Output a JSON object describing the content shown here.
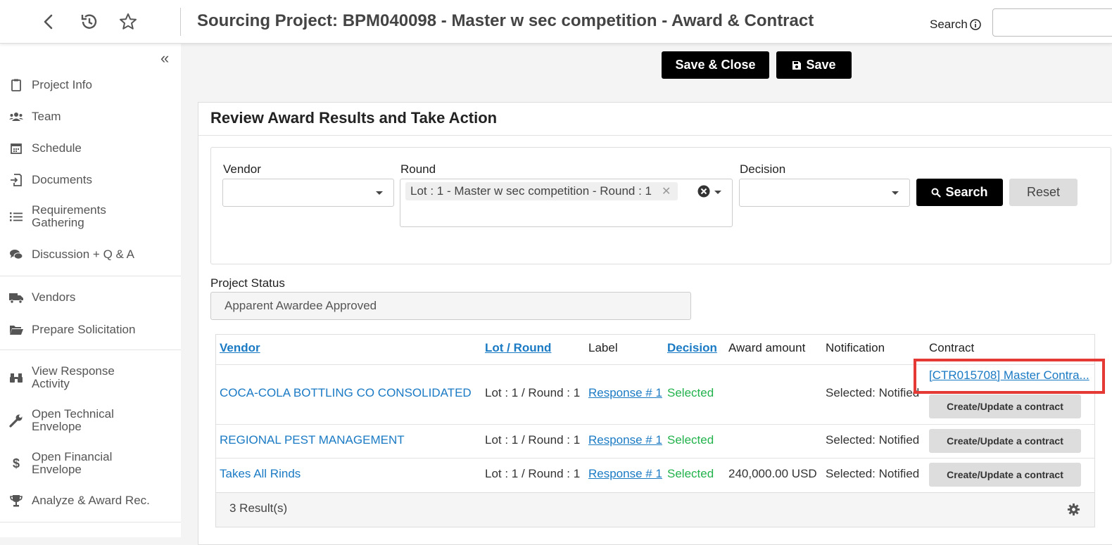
{
  "header": {
    "title": "Sourcing Project: BPM040098 - Master w sec competition - Award & Contract",
    "search_label": "Search",
    "search_value": ""
  },
  "sidebar": {
    "items": [
      {
        "label": "Project Info",
        "icon": "clipboard-icon"
      },
      {
        "label": "Team",
        "icon": "users-icon"
      },
      {
        "label": "Schedule",
        "icon": "calendar-icon"
      },
      {
        "label": "Documents",
        "icon": "document-import-icon"
      },
      {
        "label": "Requirements Gathering",
        "icon": "list-icon"
      },
      {
        "label": "Discussion + Q & A",
        "icon": "comments-icon"
      },
      {
        "label": "Vendors",
        "icon": "truck-icon"
      },
      {
        "label": "Prepare Solicitation",
        "icon": "folder-open-icon"
      },
      {
        "label": "View Response Activity",
        "icon": "binoculars-icon"
      },
      {
        "label": "Open Technical Envelope",
        "icon": "wrench-icon"
      },
      {
        "label": "Open Financial Envelope",
        "icon": "dollar-icon"
      },
      {
        "label": "Analyze & Award Rec.",
        "icon": "trophy-icon"
      }
    ]
  },
  "actions": {
    "save_close": "Save & Close",
    "save": "Save"
  },
  "panel": {
    "title": "Review Award Results and Take Action"
  },
  "filters": {
    "vendor_label": "Vendor",
    "vendor_value": "",
    "round_label": "Round",
    "round_chip": "Lot : 1 - Master w sec competition - Round : 1",
    "decision_label": "Decision",
    "decision_value": "",
    "search_button": "Search",
    "reset_button": "Reset"
  },
  "project_status": {
    "label": "Project Status",
    "value": "Apparent Awardee Approved"
  },
  "table": {
    "columns": [
      "Vendor",
      "Lot / Round",
      "Label",
      "Decision",
      "Award amount",
      "Notification",
      "Contract"
    ],
    "rows": [
      {
        "vendor": "COCA-COLA BOTTLING CO CONSOLIDATED",
        "lot_round": "Lot : 1 / Round : 1",
        "label": "Response # 1",
        "decision": "Selected",
        "award_amount": "",
        "notification": "Selected: Notified",
        "contract_link": "[CTR015708] Master Contra...",
        "contract_button": "Create/Update a contract"
      },
      {
        "vendor": "REGIONAL PEST MANAGEMENT",
        "lot_round": "Lot : 1 / Round : 1",
        "label": "Response # 1",
        "decision": "Selected",
        "award_amount": "",
        "notification": "Selected: Notified",
        "contract_link": "",
        "contract_button": "Create/Update a contract"
      },
      {
        "vendor": "Takes All Rinds",
        "lot_round": "Lot : 1 / Round : 1",
        "label": "Response # 1",
        "decision": "Selected",
        "award_amount": "240,000.00 USD",
        "notification": "Selected: Notified",
        "contract_link": "",
        "contract_button": "Create/Update a contract"
      }
    ],
    "result_count": "3 Result(s)"
  },
  "colors": {
    "link": "#1a7ac4",
    "selected": "#22b24c",
    "highlight": "#e53935",
    "button_dark": "#000000"
  }
}
